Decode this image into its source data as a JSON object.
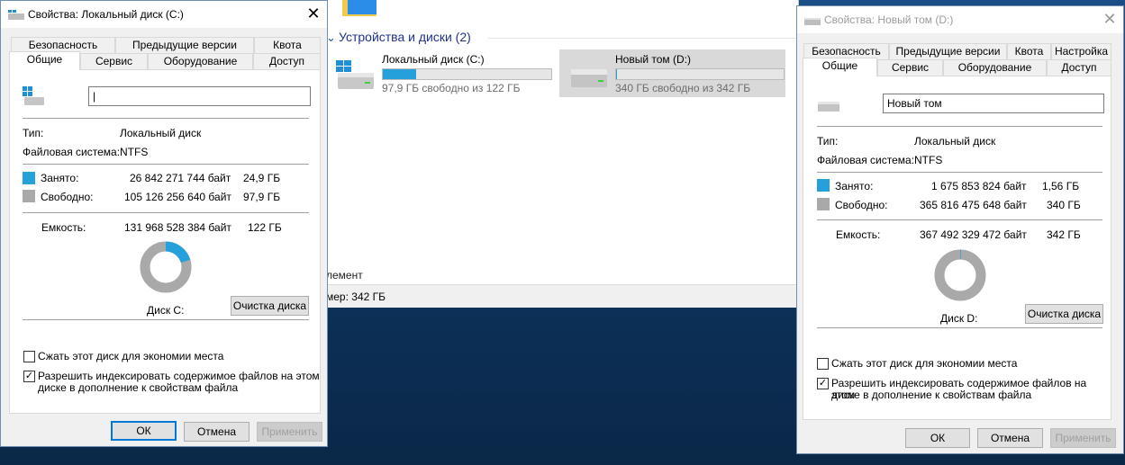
{
  "explorer": {
    "section_title": "Устройства и диски (2)",
    "drives": [
      {
        "name": "Локальный диск (C:)",
        "free_text": "97,9 ГБ свободно из 122 ГБ",
        "used_fraction": 0.2
      },
      {
        "name": "Новый том (D:)",
        "free_text": "340 ГБ свободно из 342 ГБ",
        "used_fraction": 0.005
      }
    ],
    "fragment_elements": "лемент",
    "status_text": "мер: 342 ГБ"
  },
  "dialog_c": {
    "title": "Свойства: Локальный диск (C:)",
    "tabs_row1": [
      "Безопасность",
      "Предыдущие версии",
      "Квота"
    ],
    "tabs_row2": [
      "Общие",
      "Сервис",
      "Оборудование",
      "Доступ"
    ],
    "volume_name": "",
    "type_label": "Тип:",
    "type_value": "Локальный диск",
    "fs_label": "Файловая система:",
    "fs_value": "NTFS",
    "used_label": "Занято:",
    "used_bytes": "26 842 271 744 байт",
    "used_size": "24,9 ГБ",
    "free_label": "Свободно:",
    "free_bytes": "105 126 256 640 байт",
    "free_size": "97,9 ГБ",
    "cap_label": "Емкость:",
    "cap_bytes": "131 968 528 384 байт",
    "cap_size": "122 ГБ",
    "used_fraction": 0.203,
    "disk_label": "Диск C:",
    "cleanup_button": "Очистка диска",
    "compress_label": "Сжать этот диск для экономии места",
    "compress_checked": false,
    "index_label_1": "Разрешить индексировать содержимое файлов на этом",
    "index_label_2": "диске в дополнение к свойствам файла",
    "index_checked": true,
    "ok": "ОК",
    "cancel": "Отмена",
    "apply": "Применить"
  },
  "dialog_d": {
    "title": "Свойства: Новый том (D:)",
    "tabs_row1": [
      "Безопасность",
      "Предыдущие версии",
      "Квота",
      "Настройка"
    ],
    "tabs_row2": [
      "Общие",
      "Сервис",
      "Оборудование",
      "Доступ"
    ],
    "volume_name": "Новый том",
    "type_label": "Тип:",
    "type_value": "Локальный диск",
    "fs_label": "Файловая система:",
    "fs_value": "NTFS",
    "used_label": "Занято:",
    "used_bytes": "1 675 853 824 байт",
    "used_size": "1,56 ГБ",
    "free_label": "Свободно:",
    "free_bytes": "365 816 475 648 байт",
    "free_size": "340 ГБ",
    "cap_label": "Емкость:",
    "cap_bytes": "367 492 329 472 байт",
    "cap_size": "342 ГБ",
    "used_fraction": 0.005,
    "disk_label": "Диск D:",
    "cleanup_button": "Очистка диска",
    "compress_label": "Сжать этот диск для экономии места",
    "compress_checked": false,
    "index_label_1": "Разрешить индексировать содержимое файлов на этом",
    "index_label_2": "диске в дополнение к свойствам файла",
    "index_checked": true,
    "ok": "ОК",
    "cancel": "Отмена",
    "apply": "Применить"
  },
  "colors": {
    "used": "#26a0da",
    "free": "#a9a9a9",
    "accent": "#0078d7"
  }
}
